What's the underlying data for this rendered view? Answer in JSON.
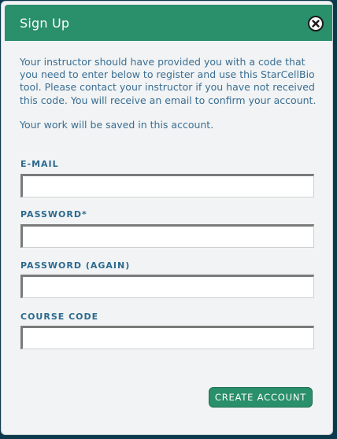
{
  "dialog": {
    "title": "Sign Up",
    "close_icon": "close-circle-x"
  },
  "intro_text": "Your instructor should have provided you with a code that you need to enter below to register and use this StarCellBio tool. Please contact your instructor if you have not received this code. You will receive an email to confirm your account.",
  "saved_text": "Your work will be saved in this account.",
  "fields": {
    "email": {
      "label": "E-MAIL",
      "value": "",
      "placeholder": ""
    },
    "password": {
      "label": "PASSWORD*",
      "value": "",
      "placeholder": ""
    },
    "password_again": {
      "label": "PASSWORD (AGAIN)",
      "value": "",
      "placeholder": ""
    },
    "course_code": {
      "label": "COURSE CODE",
      "value": "",
      "placeholder": ""
    }
  },
  "actions": {
    "create_label": "CREATE ACCOUNT"
  },
  "colors": {
    "accent": "#2a8f6b",
    "text": "#3a6e92",
    "panel": "#f1f3f4"
  }
}
